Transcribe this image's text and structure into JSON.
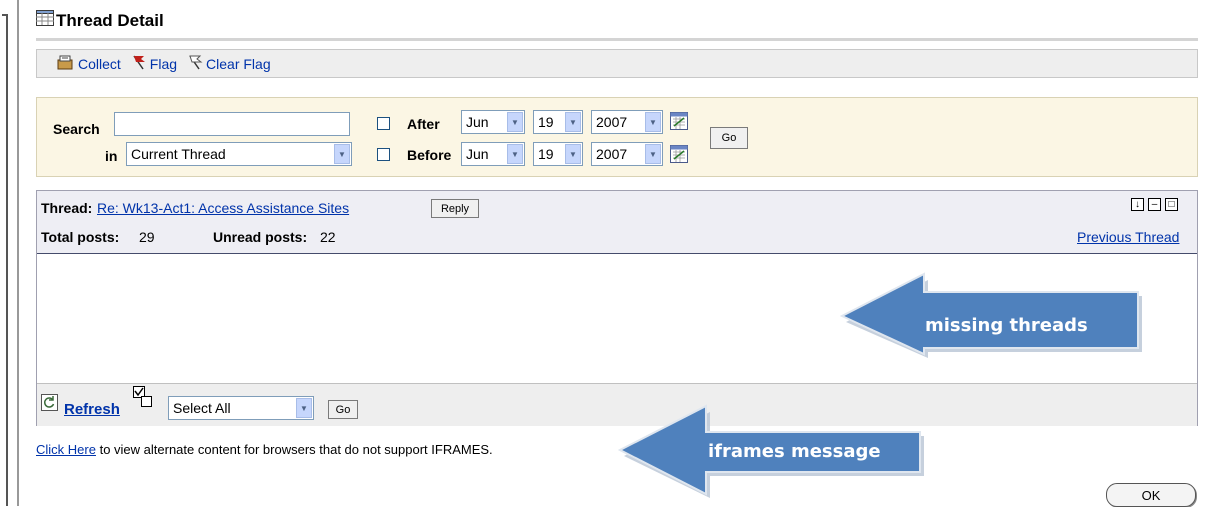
{
  "page": {
    "title": "Thread Detail"
  },
  "toolbar": {
    "collect": "Collect",
    "flag": "Flag",
    "clear_flag": "Clear Flag"
  },
  "search": {
    "search_label": "Search",
    "search_value": "",
    "in_label": "in",
    "scope_value": "Current Thread",
    "after_label": "After",
    "before_label": "Before",
    "after_month": "Jun",
    "after_day": "19",
    "after_year": "2007",
    "before_month": "Jun",
    "before_day": "19",
    "before_year": "2007",
    "go": "Go"
  },
  "thread": {
    "label": "Thread:",
    "title": "Re: Wk13-Act1: Access Assistance Sites",
    "reply": "Reply",
    "total_label": "Total posts:",
    "total_value": "29",
    "unread_label": "Unread posts:",
    "unread_value": "22",
    "previous": "Previous Thread"
  },
  "footer_bar": {
    "refresh": "Refresh",
    "select_value": "Select All",
    "go": "Go"
  },
  "iframe_msg": {
    "link": "Click Here",
    "text": "to view alternate content for browsers that do not support IFRAMES."
  },
  "annotations": {
    "missing_threads": "missing threads",
    "iframes_message": "iframes message"
  },
  "dialog": {
    "ok": "OK"
  },
  "colors": {
    "arrow_fill": "#4f81bd",
    "search_bg": "#fbf6e4",
    "link": "#0033aa"
  }
}
